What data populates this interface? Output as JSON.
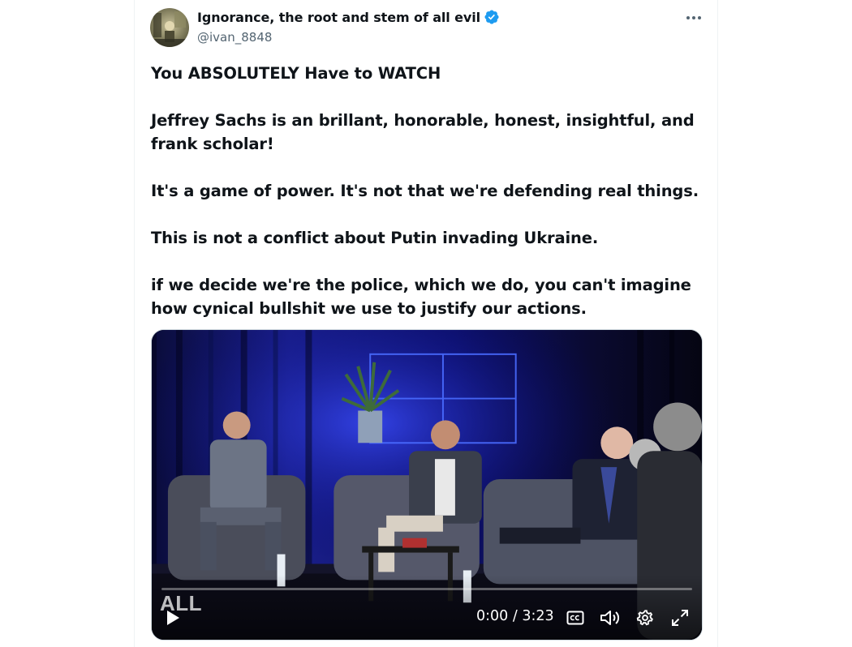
{
  "author": {
    "display_name": "Ignorance, the root and stem of all evil",
    "handle": "@ivan_8848",
    "verified": true,
    "avatar_icon": "avatar-image",
    "verified_icon": "verified-badge-icon"
  },
  "menu": {
    "more_icon": "more-horizontal-icon"
  },
  "tweet": {
    "paragraphs": [
      "You ABSOLUTELY Have to WATCH",
      "Jeffrey Sachs is an brillant, honorable, honest, insightful, and frank scholar!",
      "It's a game of power. It's not that we're defending real things.",
      "This is not a conflict about Putin invading Ukraine.",
      "if we decide we're the police, which we do, you can't imagine how cynical bullshit we use to justify our actions."
    ]
  },
  "video": {
    "watermark": "ALL",
    "current_time": "0:00",
    "duration": "3:23",
    "time_display": "0:00 / 3:23",
    "progress": 0,
    "controls": {
      "play_icon": "play-icon",
      "captions_icon": "closed-captions-icon",
      "volume_icon": "volume-icon",
      "settings_icon": "gear-icon",
      "fullscreen_icon": "fullscreen-icon"
    }
  },
  "colors": {
    "text_primary": "#0f1419",
    "text_secondary": "#536471",
    "verified_blue": "#1d9bf0",
    "border": "#eff3f4"
  }
}
